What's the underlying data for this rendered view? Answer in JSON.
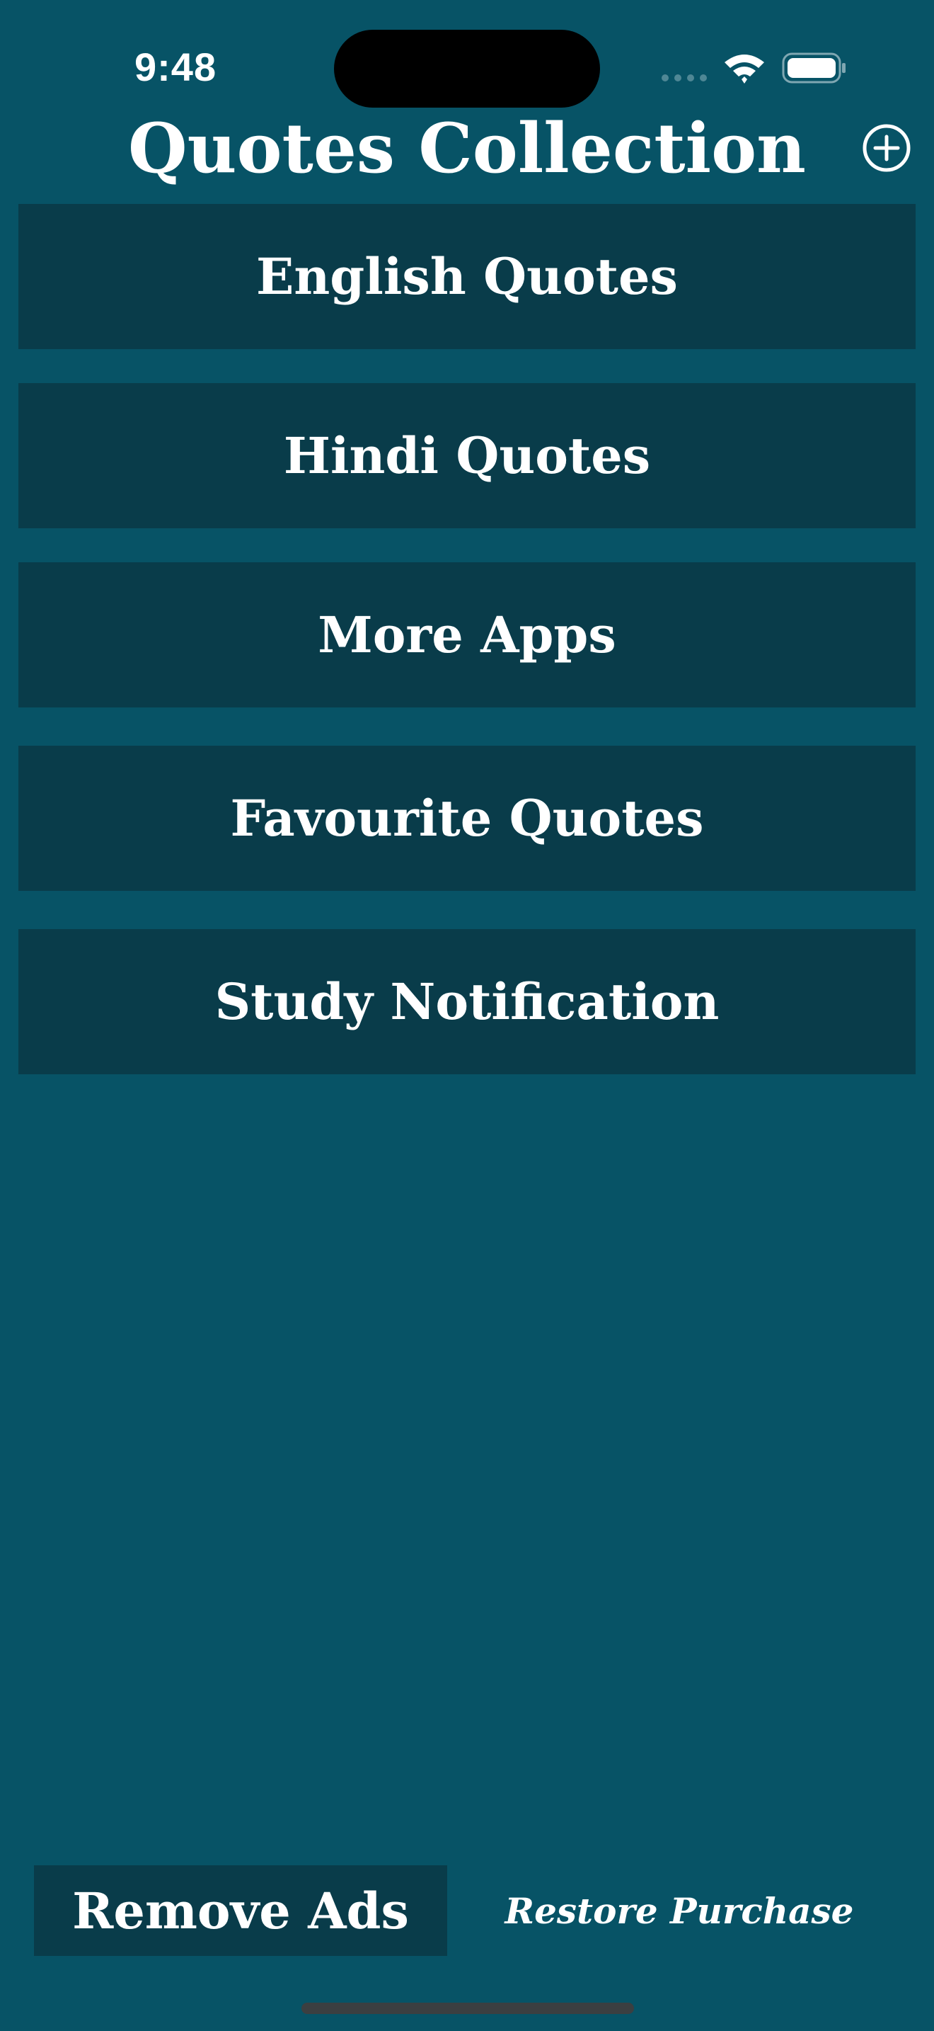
{
  "status_bar": {
    "time": "9:48",
    "wifi_icon": "wifi-icon",
    "battery_icon": "battery-icon"
  },
  "header": {
    "title": "Quotes Collection",
    "add_icon": "plus-circle-icon"
  },
  "menu": {
    "items": [
      {
        "label": "English Quotes"
      },
      {
        "label": "Hindi Quotes"
      },
      {
        "label": "More Apps"
      },
      {
        "label": "Favourite Quotes"
      },
      {
        "label": "Study Notification"
      }
    ]
  },
  "footer": {
    "remove_ads_label": "Remove Ads",
    "restore_label": "Restore Purchase"
  },
  "colors": {
    "background": "#075366",
    "button": "#093c4a",
    "text": "#ffffff"
  }
}
